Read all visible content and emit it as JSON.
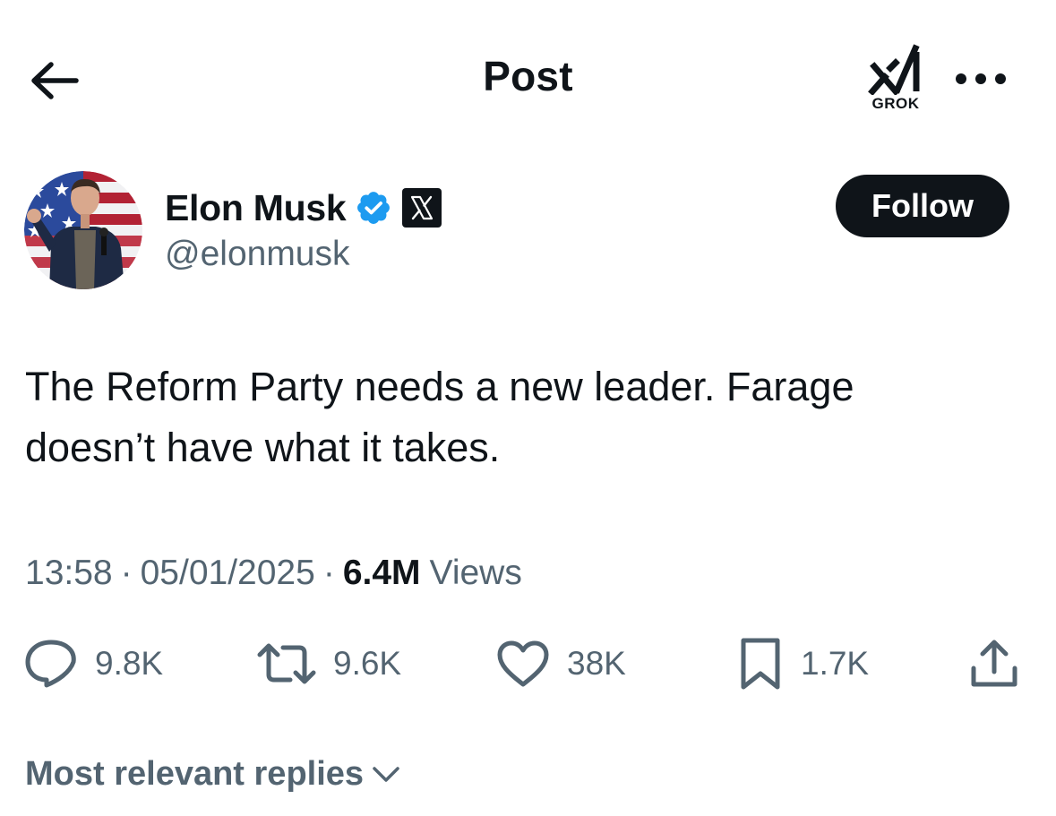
{
  "header": {
    "title": "Post",
    "grok_label": "GROK"
  },
  "author": {
    "name": "Elon Musk",
    "handle": "@elonmusk",
    "verified": true,
    "affiliation_badge": "X",
    "follow_label": "Follow"
  },
  "post": {
    "text": "The Reform Party needs a new leader. Farage\ndoesn’t have what it takes.",
    "time": "13:58",
    "date": "05/01/2025",
    "separator": "·",
    "views_count": "6.4M",
    "views_label": "Views"
  },
  "actions": {
    "replies": "9.8K",
    "reposts": "9.6K",
    "likes": "38K",
    "bookmarks": "1.7K"
  },
  "replies_sort": {
    "label": "Most relevant replies"
  },
  "colors": {
    "text_primary": "#0f1419",
    "text_secondary": "#536471",
    "verified_blue": "#1d9bf0",
    "follow_bg": "#0f1419",
    "background": "#ffffff"
  },
  "icons": {
    "back": "arrow-left-icon",
    "grok": "grok-logo-icon",
    "more": "more-horizontal-icon",
    "verified": "verified-badge-icon",
    "affiliation": "x-logo-icon",
    "reply": "speech-bubble-icon",
    "repost": "repost-arrows-icon",
    "like": "heart-icon",
    "bookmark": "bookmark-icon",
    "share": "share-upload-icon",
    "sort": "chevron-down-icon"
  }
}
